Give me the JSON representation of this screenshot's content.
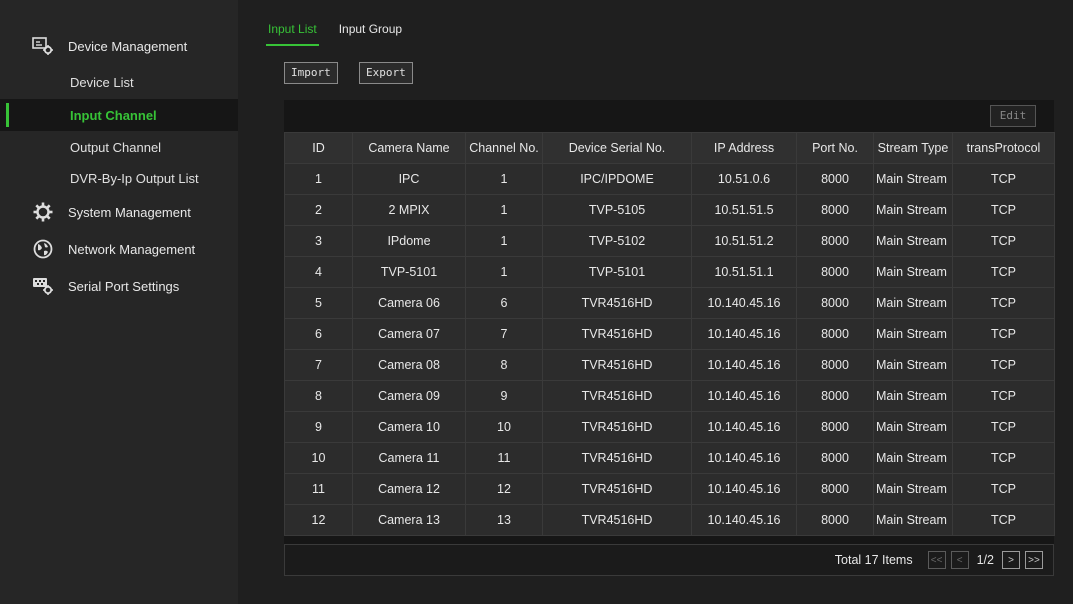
{
  "sidebar": {
    "groups": [
      {
        "label": "Device Management",
        "icon": "device-management-icon"
      },
      {
        "label": "System Management",
        "icon": "gear-icon"
      },
      {
        "label": "Network Management",
        "icon": "globe-icon"
      },
      {
        "label": "Serial Port Settings",
        "icon": "serial-port-icon"
      }
    ],
    "sub_items": [
      {
        "label": "Device List"
      },
      {
        "label": "Input Channel",
        "active": true
      },
      {
        "label": "Output Channel"
      },
      {
        "label": "DVR-By-Ip Output List"
      }
    ],
    "accent_color": "#37c337"
  },
  "tabs": [
    {
      "label": "Input List",
      "active": true
    },
    {
      "label": "Input Group",
      "active": false
    }
  ],
  "toolbar": {
    "import_label": "Import",
    "export_label": "Export"
  },
  "panel": {
    "edit_label": "Edit"
  },
  "table": {
    "columns": [
      "ID",
      "Camera Name",
      "Channel No.",
      "Device Serial No.",
      "IP Address",
      "Port No.",
      "Stream Type",
      "transProtocol"
    ],
    "rows": [
      [
        "1",
        "IPC",
        "1",
        "IPC/IPDOME",
        "10.51.0.6",
        "8000",
        "Main Stream",
        "TCP"
      ],
      [
        "2",
        "2 MPIX",
        "1",
        "TVP-5105",
        "10.51.51.5",
        "8000",
        "Main Stream",
        "TCP"
      ],
      [
        "3",
        "IPdome",
        "1",
        "TVP-5102",
        "10.51.51.2",
        "8000",
        "Main Stream",
        "TCP"
      ],
      [
        "4",
        "TVP-5101",
        "1",
        "TVP-5101",
        "10.51.51.1",
        "8000",
        "Main Stream",
        "TCP"
      ],
      [
        "5",
        "Camera 06",
        "6",
        "TVR4516HD",
        "10.140.45.16",
        "8000",
        "Main Stream",
        "TCP"
      ],
      [
        "6",
        "Camera 07",
        "7",
        "TVR4516HD",
        "10.140.45.16",
        "8000",
        "Main Stream",
        "TCP"
      ],
      [
        "7",
        "Camera 08",
        "8",
        "TVR4516HD",
        "10.140.45.16",
        "8000",
        "Main Stream",
        "TCP"
      ],
      [
        "8",
        "Camera 09",
        "9",
        "TVR4516HD",
        "10.140.45.16",
        "8000",
        "Main Stream",
        "TCP"
      ],
      [
        "9",
        "Camera 10",
        "10",
        "TVR4516HD",
        "10.140.45.16",
        "8000",
        "Main Stream",
        "TCP"
      ],
      [
        "10",
        "Camera 11",
        "11",
        "TVR4516HD",
        "10.140.45.16",
        "8000",
        "Main Stream",
        "TCP"
      ],
      [
        "11",
        "Camera 12",
        "12",
        "TVR4516HD",
        "10.140.45.16",
        "8000",
        "Main Stream",
        "TCP"
      ],
      [
        "12",
        "Camera 13",
        "13",
        "TVR4516HD",
        "10.140.45.16",
        "8000",
        "Main Stream",
        "TCP"
      ]
    ]
  },
  "pagination": {
    "total_text": "Total 17 Items",
    "first": "<<",
    "prev": "<",
    "page_text": "1/2",
    "next": ">",
    "last": ">>"
  }
}
